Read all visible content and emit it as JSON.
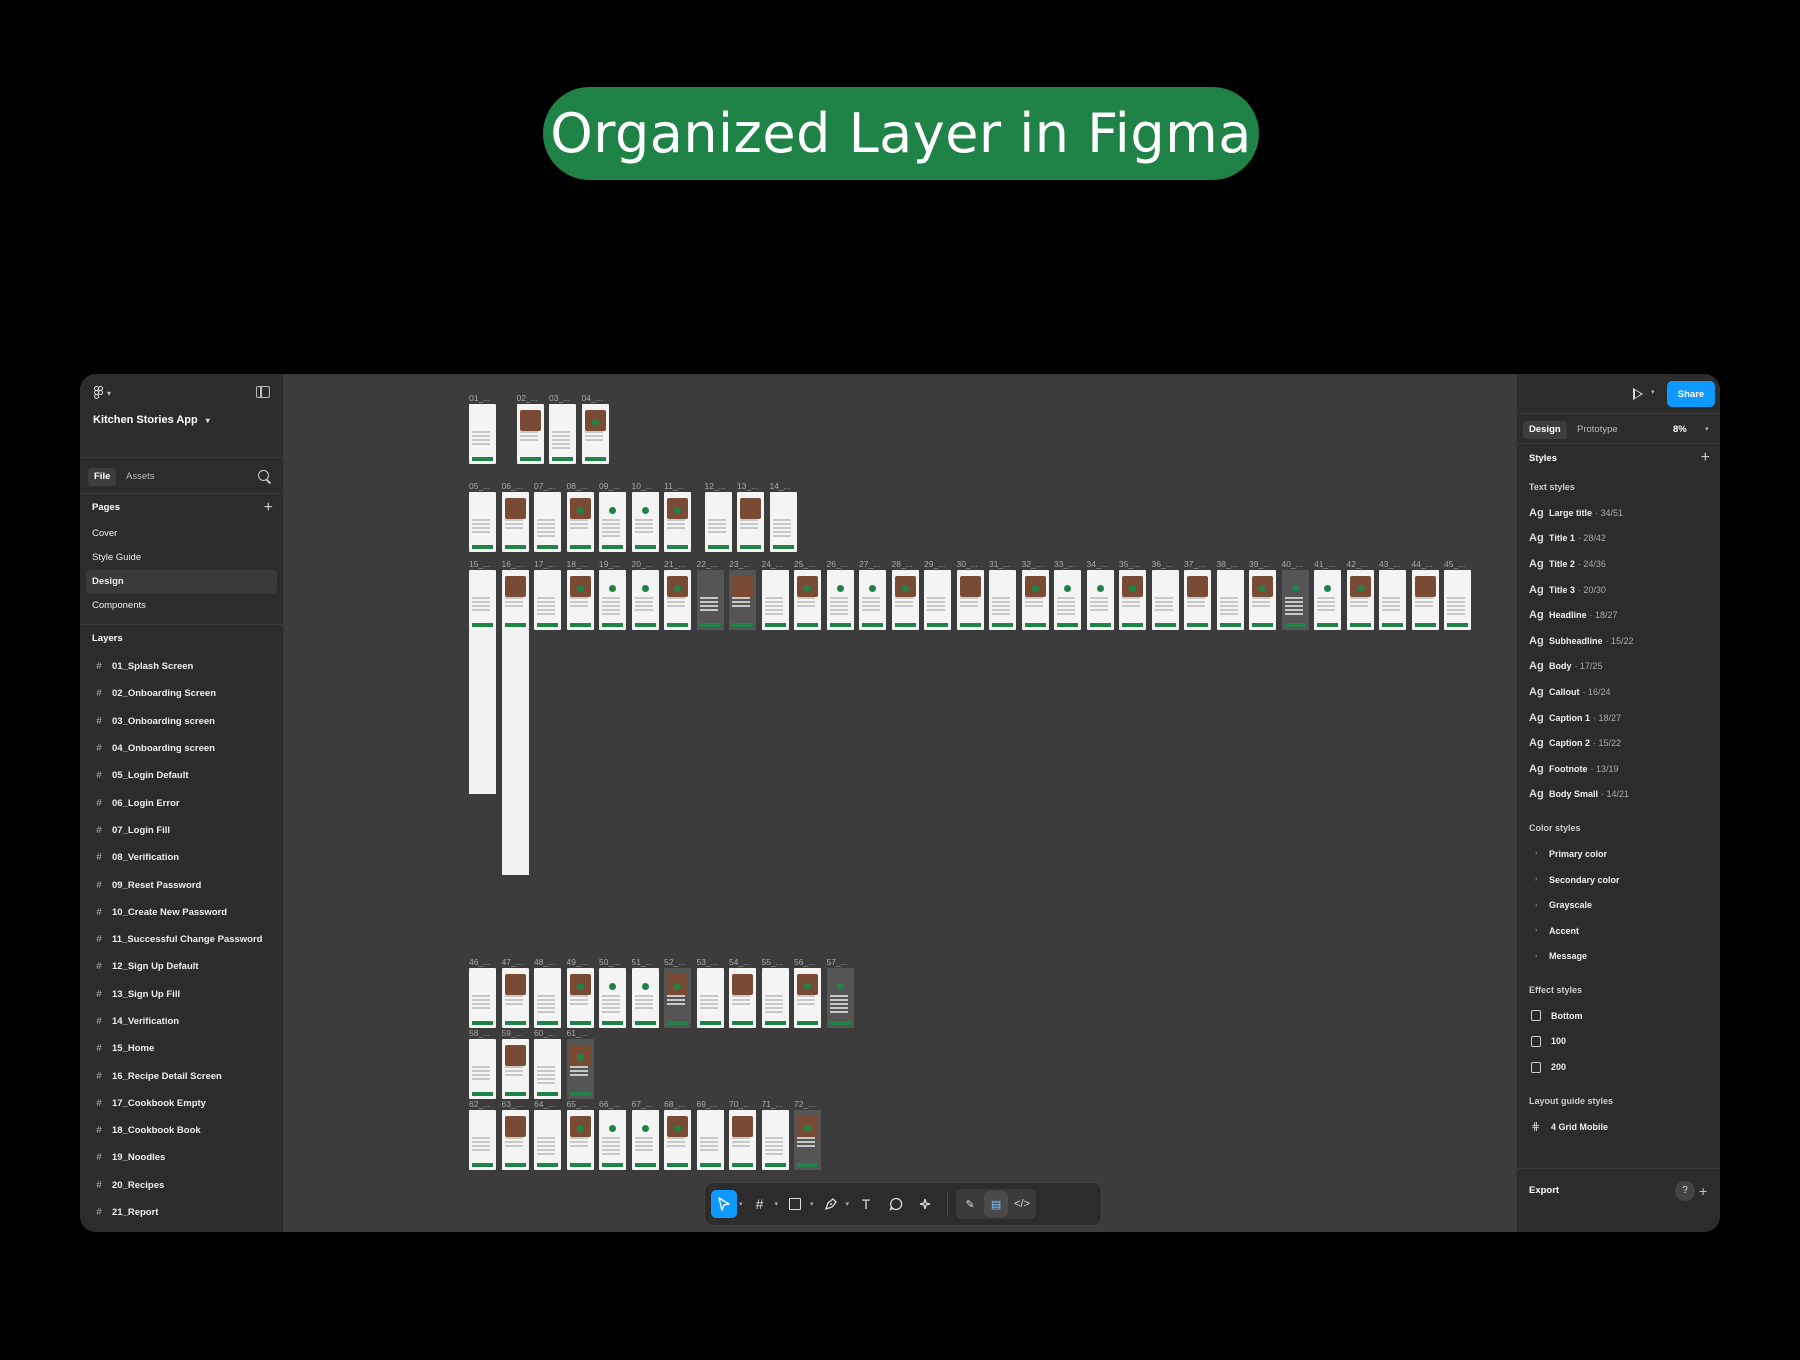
{
  "hero": {
    "title": "Organized Layer in Figma"
  },
  "left_panel": {
    "file_name": "Kitchen Stories App",
    "tabs": [
      "File",
      "Assets"
    ],
    "pages_header": "Pages",
    "pages": [
      "Cover",
      "Style Guide",
      "Design",
      "Components"
    ],
    "selected_page": "Design",
    "layers_header": "Layers",
    "layers": [
      "01_Splash Screen",
      "02_Onboarding Screen",
      "03_Onboarding screen",
      "04_Onboarding screen",
      "05_Login Default",
      "06_Login  Error",
      "07_Login Fill",
      "08_Verification",
      "09_Reset Password",
      "10_Create New Password",
      "11_Successful Change Password",
      "12_Sign Up Default",
      "13_Sign Up Fill",
      "14_Verification",
      "15_Home",
      "16_Recipe Detail Screen",
      "17_Cookbook Empty",
      "18_Cookbook Book",
      "19_Noodles",
      "20_Recipes",
      "21_Report"
    ]
  },
  "canvas": {
    "row1_labels": [
      "01_...",
      "02_...",
      "03_...",
      "04_..."
    ],
    "row2_labels": [
      "05_...",
      "06_...",
      "07_...",
      "08_...",
      "09_...",
      "10_...",
      "11_...",
      "12_...",
      "13_...",
      "14_..."
    ],
    "row3_labels": [
      "15_...",
      "16_...",
      "17_...",
      "18_...",
      "19_...",
      "20_...",
      "21_...",
      "22_...",
      "23_...",
      "24_...",
      "25_...",
      "26_...",
      "27_...",
      "28_...",
      "29_...",
      "30_...",
      "31_...",
      "32_...",
      "33_...",
      "34_...",
      "35_...",
      "36_...",
      "37_...",
      "38_...",
      "39_...",
      "40_...",
      "41_...",
      "42_...",
      "43_...",
      "44_...",
      "45_..."
    ],
    "row4_labels": [
      "46_...",
      "47_...",
      "48_...",
      "49_...",
      "50_...",
      "51_...",
      "52_...",
      "53_...",
      "54_...",
      "55_...",
      "56_...",
      "57_..."
    ],
    "row5_labels": [
      "58_...",
      "59_...",
      "60_...",
      "61_..."
    ],
    "row6_labels": [
      "62_...",
      "63_...",
      "64_...",
      "65_...",
      "66_...",
      "67_...",
      "68_...",
      "69_...",
      "70_...",
      "71_...",
      "72_..."
    ]
  },
  "toolbar": {
    "tools": [
      "move-tool",
      "frame-tool",
      "shape-tool",
      "pen-tool",
      "text-tool",
      "comment-tool",
      "actions-tool"
    ],
    "mode_tools": [
      "draw-mode",
      "design-mode",
      "dev-mode"
    ]
  },
  "right_panel": {
    "share_label": "Share",
    "tabs": [
      "Design",
      "Prototype"
    ],
    "zoom": "8%",
    "styles_header": "Styles",
    "text_styles_header": "Text styles",
    "text_styles": [
      {
        "name": "Large title",
        "meta": "· 34/51"
      },
      {
        "name": "Title 1",
        "meta": "· 28/42"
      },
      {
        "name": "Title 2",
        "meta": "· 24/36"
      },
      {
        "name": "Title 3",
        "meta": "· 20/30"
      },
      {
        "name": "Headline",
        "meta": "· 18/27"
      },
      {
        "name": "Subheadline",
        "meta": "· 15/22"
      },
      {
        "name": "Body",
        "meta": "· 17/25"
      },
      {
        "name": "Callout",
        "meta": "· 16/24"
      },
      {
        "name": "Caption 1",
        "meta": "· 18/27"
      },
      {
        "name": "Caption 2",
        "meta": "· 15/22"
      },
      {
        "name": "Footnote",
        "meta": "· 13/19"
      },
      {
        "name": "Body Small",
        "meta": "· 14/21"
      }
    ],
    "ag_glyph": "Ag",
    "color_styles_header": "Color styles",
    "color_styles": [
      "Primary color",
      "Secondary color",
      "Grayscale",
      "Accent",
      "Message"
    ],
    "effect_styles_header": "Effect styles",
    "effect_styles": [
      "Bottom",
      "100",
      "200"
    ],
    "layout_styles_header": "Layout guide styles",
    "layout_styles": [
      "4 Grid Mobile"
    ],
    "export_label": "Export",
    "help_label": "?"
  },
  "colors": {
    "brand_green": "#1f8246",
    "accent_blue": "#0d99ff",
    "panel_bg": "#2c2c2c",
    "canvas_bg": "#3c3c3c"
  }
}
